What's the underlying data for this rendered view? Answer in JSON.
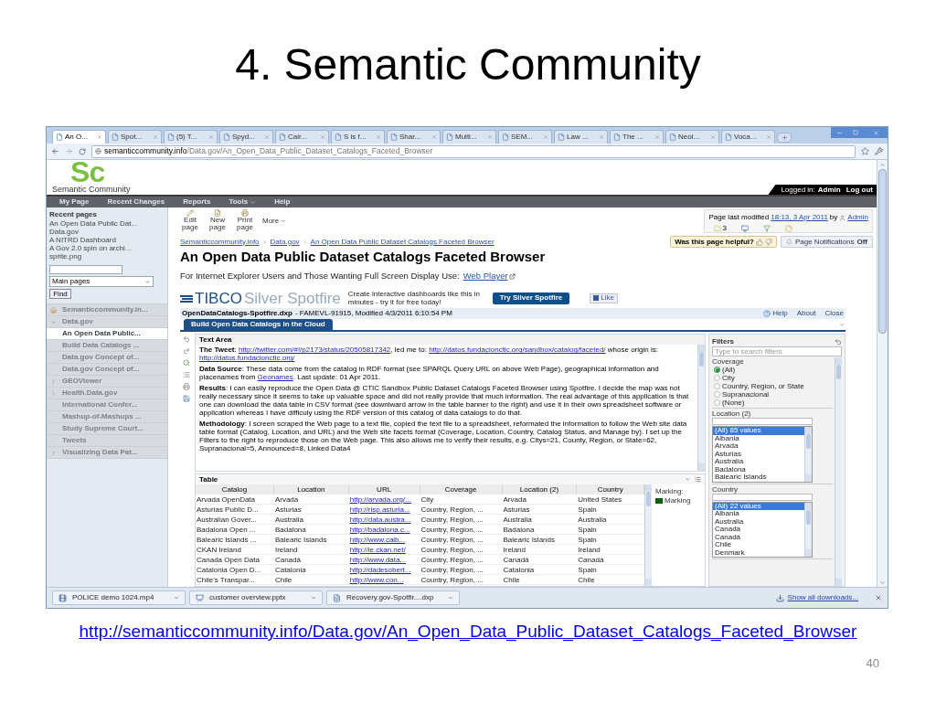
{
  "slide": {
    "title": "4. Semantic Community",
    "url": "http://semanticcommunity.info/Data.gov/An_Open_Data_Public_Dataset_Catalogs_Faceted_Browser",
    "page_number": "40"
  },
  "browser": {
    "tabs": [
      {
        "label": "An O...",
        "selected": true
      },
      {
        "label": "Spot...",
        "selected": false
      },
      {
        "label": "(5) T...",
        "selected": false
      },
      {
        "label": "Spyd...",
        "selected": false
      },
      {
        "label": "Cair...",
        "selected": false
      },
      {
        "label": "S is f...",
        "selected": false
      },
      {
        "label": "Shar...",
        "selected": false
      },
      {
        "label": "Multi...",
        "selected": false
      },
      {
        "label": "SEM...",
        "selected": false
      },
      {
        "label": "Law ...",
        "selected": false
      },
      {
        "label": "The ...",
        "selected": false
      },
      {
        "label": "Neol...",
        "selected": false
      },
      {
        "label": "Voca...",
        "selected": false
      }
    ],
    "address": {
      "host": "semanticcommunity.info",
      "path": "/Data.gov/An_Open_Data_Public_Dataset_Catalogs_Faceted_Browser"
    }
  },
  "site": {
    "logo_mark": "Sc",
    "logo_name": "Semantic Community",
    "login": {
      "prefix": "Logged in:",
      "user": "Admin",
      "logout": "Log out"
    },
    "nav": [
      {
        "label": "My Page",
        "has_menu": false
      },
      {
        "label": "Recent Changes",
        "has_menu": false
      },
      {
        "label": "Reports",
        "has_menu": false
      },
      {
        "label": "Tools",
        "has_menu": true
      },
      {
        "label": "Help",
        "has_menu": false
      }
    ]
  },
  "sidebar": {
    "recent_title": "Recent pages",
    "recent": [
      "An Open Data Public Dat...",
      "Data.gov",
      "A NITRD Dashboard",
      "A Gov 2.0 spin on archi...",
      "sprite.png"
    ],
    "select": "Main pages",
    "find": "Find",
    "tree": [
      {
        "label": "Semanticcommunity.in...",
        "selected": false
      },
      {
        "label": "Data.gov",
        "selected": false,
        "expanded": true,
        "children": [
          {
            "label": "An Open Data Public...",
            "selected": true
          },
          {
            "label": "Build Data Catalogs ...",
            "selected": false
          },
          {
            "label": "Data.gov Concept of...",
            "selected": false
          },
          {
            "label": "Data.gov Concept of...",
            "selected": false
          }
        ]
      },
      {
        "label": "GEOViewer",
        "selected": false,
        "expanded": false
      },
      {
        "label": "Health.Data.gov",
        "selected": false,
        "expanded": false
      },
      {
        "label": "International Confer...",
        "selected": false
      },
      {
        "label": "Mashup-of-Mashups ...",
        "selected": false
      },
      {
        "label": "Study Supreme Court...",
        "selected": false
      },
      {
        "label": "Tweets",
        "selected": false
      },
      {
        "label": "Visualizing Data Pat...",
        "selected": false,
        "expanded": false
      }
    ]
  },
  "page": {
    "toolbar": [
      {
        "label": "Edit page",
        "kind": "edit"
      },
      {
        "label": "New page",
        "kind": "new"
      },
      {
        "label": "Print page",
        "kind": "print"
      },
      {
        "label": "More",
        "kind": "menu"
      }
    ],
    "info": {
      "prefix": "Page last modified",
      "date": "18:13, 3 Apr 2011",
      "by": "by",
      "user": "Admin",
      "comments": "3"
    },
    "breadcrumbs": [
      "Semanticcommunity.info",
      "Data.gov",
      "An Open Data Public Dataset Catalogs Faceted Browser"
    ],
    "helpful": "Was this page helpful?",
    "notifications": {
      "label": "Page Notifications",
      "state": "Off"
    },
    "title": "An Open Data Public Dataset Catalogs Faceted Browser",
    "subtitle": "For Internet Explorer Users and Those Wanting Full Screen Display Use:",
    "subtitle_link": "Web Player"
  },
  "spotfire": {
    "brand": "TIBCO",
    "product": "Silver Spotfire",
    "promo": "Create interactive dashboards like this in minutes - try it for free today!",
    "try_button": "Try Silver Spotfire",
    "like": "Like",
    "file": "OpenDataCatalogs-Spotfire.dxp",
    "file_info": "- FAMEVL-91915, Modified 4/3/2011 6:10:54 PM",
    "menu": [
      "Help",
      "About",
      "Close"
    ],
    "tabs": [
      {
        "label": "Build Open Data Catalogs in the Cloud",
        "selected": true
      }
    ],
    "text_area": {
      "title": "Text Area",
      "paragraphs": [
        {
          "label": "The Tweet",
          "parts": [
            {
              "kind": "text",
              "text": ": "
            },
            {
              "kind": "link",
              "text": "http://twitter.com/#!/p2173/status/20505817342"
            },
            {
              "kind": "text",
              "text": ", led me to: "
            },
            {
              "kind": "link",
              "text": "http://datos.fundacionctic.org/sandbox/catalog/faceted/"
            },
            {
              "kind": "text",
              "text": " whose origin is: "
            },
            {
              "kind": "link",
              "text": "http://datos.fundacionctic.org/"
            }
          ]
        },
        {
          "label": "Data Source",
          "parts": [
            {
              "kind": "text",
              "text": ": These data come from the catalog in RDF format (see SPARQL Query URL on above Web Page), geographical information and placenames from "
            },
            {
              "kind": "link",
              "text": "Geonames"
            },
            {
              "kind": "text",
              "text": ". Last update: 01 Apr 2011."
            }
          ]
        },
        {
          "label": "Results",
          "parts": [
            {
              "kind": "text",
              "text": ": I can easily reproduce the Open Data @ CTIC Sandbox Public Dataset Catalogs Faceted Browser using Spotfire. I decide the map was not really necessary since it seems to take up valuable space and did not really provide that much information. The real advantage of this application is that one can download the data table in CSV format (see downlward arrow in the table banner to the right) and use it in their own spreadsheet software or application whereas I have difficuly using the RDF version of this catalog of data catalogs to do that."
            }
          ]
        },
        {
          "label": "Methodology",
          "parts": [
            {
              "kind": "text",
              "text": ": I screen scraped the Web page to a text file, copied the text file to a spreadsheet, reformated the information to follow the Web site data table format (Catalog, Location, and URL) and the Web site facets format (Coverage, Location, Country, Catalog Status, and Manage by). I set up the Filters to the right to reproduce those on the Web page. This also allows me to verify their results, e.g. Citys=21, County, Region, or State=62, Supranacional=5, Announced=8, Linked Data4"
            }
          ]
        }
      ]
    },
    "table": {
      "title": "Table",
      "columns": [
        {
          "label": "Catalog",
          "kind": "text"
        },
        {
          "label": "Location",
          "kind": "text"
        },
        {
          "label": "URL",
          "kind": "link"
        },
        {
          "label": "Coverage",
          "kind": "text"
        },
        {
          "label": "Location (2)",
          "kind": "text"
        },
        {
          "label": "Country",
          "kind": "text"
        }
      ],
      "rows": [
        [
          "Arvada OpenData",
          "Arvada",
          "http://arvada.org/...",
          "City",
          "Arvada",
          "United States"
        ],
        [
          "Asturias Public D...",
          "Asturias",
          "http://risp.asturia...",
          "Country, Region, ...",
          "Asturias",
          "Spain"
        ],
        [
          "Australian Gover...",
          "Australia",
          "http://data.austra...",
          "Country, Region, ...",
          "Australia",
          "Australia"
        ],
        [
          "Badalona Open ...",
          "Badalona",
          "http://badalona.c...",
          "Country, Region, ...",
          "Badalona",
          "Spain"
        ],
        [
          "Balearic Islands ...",
          "Balearic Islands",
          "http://www.caib...",
          "Country, Region, ...",
          "Balearic Islands",
          "Spain"
        ],
        [
          "CKAN Ireland",
          "Ireland",
          "http://ie.ckan.net/",
          "Country, Region, ...",
          "Ireland",
          "Ireland"
        ],
        [
          "Canada Open Data",
          "Canadá",
          "http://www.data...",
          "Country, Region, ...",
          "Canadá",
          "Canadá"
        ],
        [
          "Catalonia Open D...",
          "Catalonia",
          "http://dadesobert...",
          "Country, Region, ...",
          "Catalonia",
          "Spain"
        ],
        [
          "Chile's Transpar...",
          "Chile",
          "http://www.con...",
          "Country, Region, ...",
          "Chile",
          "Chile"
        ]
      ]
    },
    "marking": {
      "title": "Marking:",
      "items": [
        {
          "label": "Marking",
          "color": "#006400"
        }
      ]
    },
    "filters": {
      "title": "Filters",
      "search_placeholder": "Type to search filters",
      "groups": [
        {
          "kind": "radio",
          "title": "Coverage",
          "options": [
            {
              "label": "(All)",
              "selected": true
            },
            {
              "label": "City",
              "selected": false
            },
            {
              "label": "Country, Region, or State",
              "selected": false
            },
            {
              "label": "Supranacional",
              "selected": false
            },
            {
              "label": "(None)",
              "selected": false
            }
          ]
        },
        {
          "kind": "list",
          "title": "Location (2)",
          "options": [
            {
              "label": "(All) 85 values",
              "selected": true
            },
            {
              "label": "Albania",
              "selected": false
            },
            {
              "label": "Arvada",
              "selected": false
            },
            {
              "label": "Asturias",
              "selected": false
            },
            {
              "label": "Australia",
              "selected": false
            },
            {
              "label": "Badalona",
              "selected": false
            },
            {
              "label": "Balearic Islands",
              "selected": false
            }
          ]
        },
        {
          "kind": "list",
          "title": "Country",
          "options": [
            {
              "label": "(All) 22 values",
              "selected": true
            },
            {
              "label": "Albania",
              "selected": false
            },
            {
              "label": "Australia",
              "selected": false
            },
            {
              "label": "Canada",
              "selected": false
            },
            {
              "label": "Canadá",
              "selected": false
            },
            {
              "label": "Chile",
              "selected": false
            },
            {
              "label": "Denmark",
              "selected": false
            }
          ]
        }
      ]
    }
  },
  "downloads": {
    "items": [
      {
        "name": "POLICE demo 1024.mp4",
        "kind": "video"
      },
      {
        "name": "customer overview.pptx",
        "kind": "slides"
      },
      {
        "name": "Recovery.gov-Spotfir....dxp",
        "kind": "file"
      }
    ],
    "show_all": "Show all downloads..."
  }
}
